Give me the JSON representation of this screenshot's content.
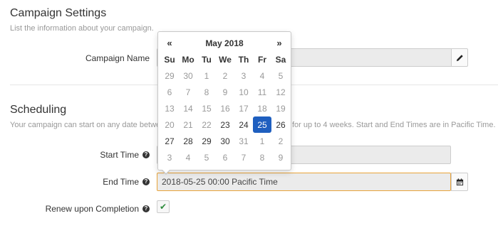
{
  "campaign_settings": {
    "title": "Campaign Settings",
    "description": "List the information about your campaign.",
    "campaign_name_label": "Campaign Name",
    "campaign_name_value": ""
  },
  "scheduling": {
    "title": "Scheduling",
    "description_left": "Your campaign can start on any date betwe",
    "description_right": "for up to 4 weeks. Start and End Times are in Pacific Time.",
    "start_time_label": "Start Time",
    "start_time_value": "",
    "end_time_label": "End Time",
    "end_time_value": "2018-05-25 00:00 Pacific Time",
    "renew_label": "Renew upon Completion",
    "renew_checked": true
  },
  "icons": {
    "edit": "pencil-icon",
    "calendar": "calendar-icon",
    "help": "question-circle-icon",
    "check": "checkmark-icon"
  },
  "colors": {
    "selected_day": "#1f5fbf",
    "focus_border": "#e8a33a",
    "checkmark": "#2e8b3c"
  },
  "datepicker": {
    "prev": "«",
    "next": "»",
    "month_title": "May 2018",
    "weekdays": [
      "Su",
      "Mo",
      "Tu",
      "We",
      "Th",
      "Fr",
      "Sa"
    ],
    "weeks": [
      [
        {
          "d": "29",
          "m": true
        },
        {
          "d": "30",
          "m": true
        },
        {
          "d": "1",
          "m": true
        },
        {
          "d": "2",
          "m": true
        },
        {
          "d": "3",
          "m": true
        },
        {
          "d": "4",
          "m": true
        },
        {
          "d": "5",
          "m": true
        }
      ],
      [
        {
          "d": "6",
          "m": true
        },
        {
          "d": "7",
          "m": true
        },
        {
          "d": "8",
          "m": true
        },
        {
          "d": "9",
          "m": true
        },
        {
          "d": "10",
          "m": true
        },
        {
          "d": "11",
          "m": true
        },
        {
          "d": "12",
          "m": true
        }
      ],
      [
        {
          "d": "13",
          "m": true
        },
        {
          "d": "14",
          "m": true
        },
        {
          "d": "15",
          "m": true
        },
        {
          "d": "16",
          "m": true
        },
        {
          "d": "17",
          "m": true
        },
        {
          "d": "18",
          "m": true
        },
        {
          "d": "19",
          "m": true
        }
      ],
      [
        {
          "d": "20",
          "m": true
        },
        {
          "d": "21",
          "m": true
        },
        {
          "d": "22",
          "m": true
        },
        {
          "d": "23",
          "m": false
        },
        {
          "d": "24",
          "m": false
        },
        {
          "d": "25",
          "m": false,
          "sel": true
        },
        {
          "d": "26",
          "m": false
        }
      ],
      [
        {
          "d": "27",
          "m": false
        },
        {
          "d": "28",
          "m": false
        },
        {
          "d": "29",
          "m": false
        },
        {
          "d": "30",
          "m": false
        },
        {
          "d": "31",
          "m": true
        },
        {
          "d": "1",
          "m": true
        },
        {
          "d": "2",
          "m": true
        }
      ],
      [
        {
          "d": "3",
          "m": true
        },
        {
          "d": "4",
          "m": true
        },
        {
          "d": "5",
          "m": true
        },
        {
          "d": "6",
          "m": true
        },
        {
          "d": "7",
          "m": true
        },
        {
          "d": "8",
          "m": true
        },
        {
          "d": "9",
          "m": true
        }
      ]
    ]
  }
}
